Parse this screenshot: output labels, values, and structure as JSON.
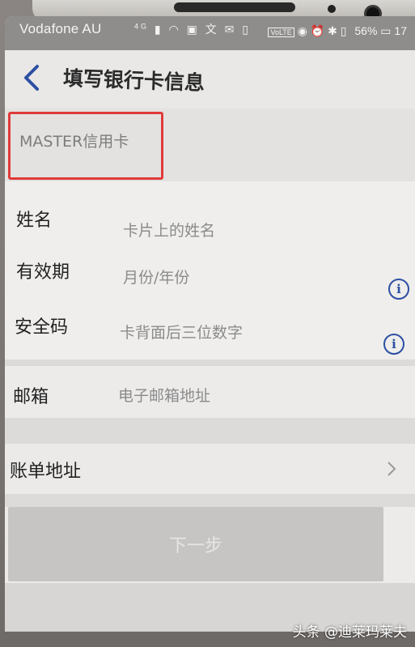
{
  "status_bar": {
    "carrier": "Vodafone AU",
    "network": "4G",
    "volte": "VoLTE",
    "battery": "56%",
    "time": "17"
  },
  "header": {
    "back_icon": "chevron-left-icon",
    "title": "填写银行卡信息"
  },
  "card_type": "MASTER信用卡",
  "form": {
    "name": {
      "label": "姓名",
      "placeholder": "卡片上的姓名"
    },
    "expiry": {
      "label": "有效期",
      "placeholder": "月份/年份"
    },
    "cvv": {
      "label": "安全码",
      "placeholder": "卡背面后三位数字"
    }
  },
  "email": {
    "label": "邮箱",
    "placeholder": "电子邮箱地址"
  },
  "billing": {
    "label": "账单地址"
  },
  "next_button": "下一步",
  "watermark": "头条 @迪莱玛莱夫",
  "colors": {
    "accent": "#2c4fa3",
    "highlight": "#e03a3a"
  }
}
